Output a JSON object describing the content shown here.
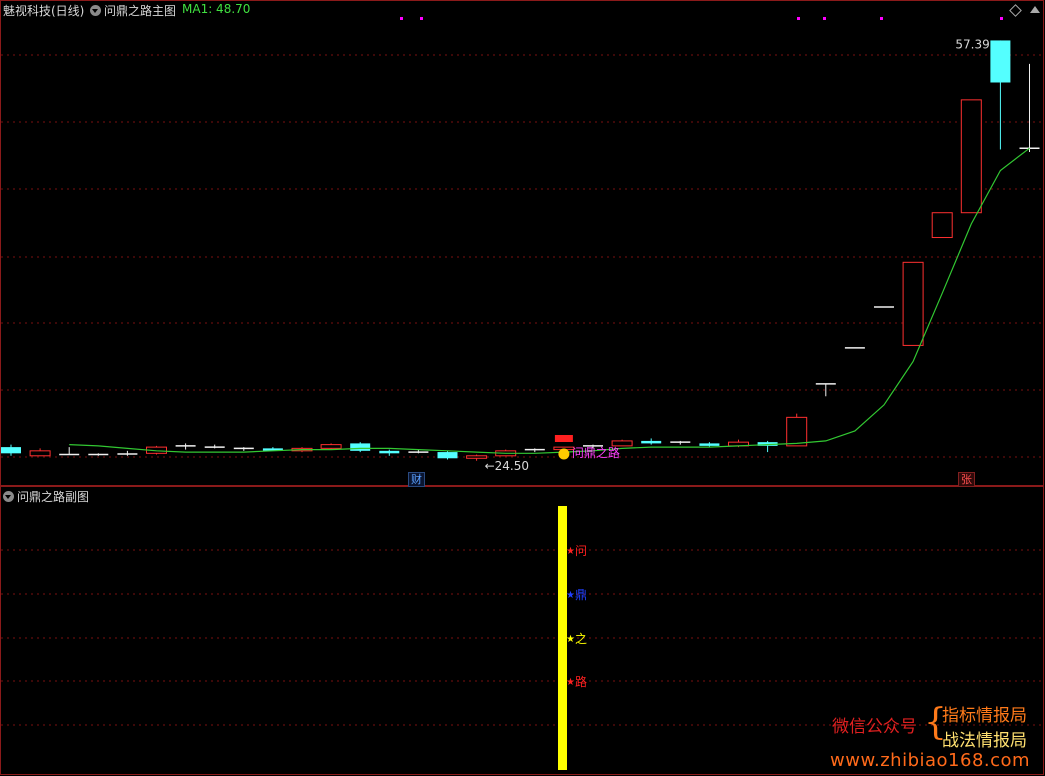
{
  "main_panel": {
    "title": "魅视科技(日线)",
    "indicator_name": "问鼎之路主图",
    "ma_label": "MA1: 48.70",
    "high_label": "57.39",
    "low_label": "←24.50",
    "signal_label": "问鼎之路",
    "marker_cai": "财",
    "marker_zhang": "张"
  },
  "sub_panel": {
    "title": "问鼎之路副图",
    "stars": [
      {
        "char": "问",
        "color": "#ff2020"
      },
      {
        "char": "鼎",
        "color": "#2040ff"
      },
      {
        "char": "之",
        "color": "#ffff00"
      },
      {
        "char": "路",
        "color": "#ff2020"
      }
    ]
  },
  "watermark": {
    "left": "微信公众号",
    "brace": "{",
    "line1": "指标情报局",
    "line2": "战法情报局",
    "site": "www.zhibiao168.com"
  },
  "colors": {
    "up": "#ff3030",
    "down": "#54ffff",
    "ma": "#32c832",
    "grid": "#7a1010",
    "signal_bar": "#ffff00"
  },
  "chart_data": {
    "type": "candlestick",
    "ylim": [
      23.4,
      59.2
    ],
    "series": [
      {
        "name": "MA1",
        "values": [
          24.8,
          24.7,
          24.5,
          24.3,
          24.2,
          24.2,
          24.2,
          24.3,
          24.4,
          24.4,
          24.5,
          24.5,
          24.4,
          24.3,
          24.2,
          24.1,
          24.1,
          24.2,
          24.3,
          24.5,
          24.6,
          24.6,
          24.6,
          24.7,
          24.8,
          24.9,
          25.1,
          25.9,
          28.0,
          31.5,
          37.0,
          42.6,
          46.9,
          48.7
        ]
      }
    ],
    "candles": [
      {
        "o": 24.6,
        "h": 24.8,
        "l": 23.9,
        "c": 24.1
      },
      {
        "o": 23.9,
        "h": 24.5,
        "l": 23.9,
        "c": 24.3
      },
      {
        "o": 24.1,
        "h": 24.6,
        "l": 24.0,
        "c": 24.0
      },
      {
        "o": 23.9,
        "h": 24.1,
        "l": 23.9,
        "c": 24.0
      },
      {
        "o": 23.95,
        "h": 24.3,
        "l": 23.9,
        "c": 24.05
      },
      {
        "o": 24.1,
        "h": 24.7,
        "l": 24.0,
        "c": 24.6
      },
      {
        "o": 24.6,
        "h": 24.9,
        "l": 24.4,
        "c": 24.7
      },
      {
        "o": 24.7,
        "h": 24.8,
        "l": 24.5,
        "c": 24.6
      },
      {
        "o": 24.4,
        "h": 24.6,
        "l": 24.3,
        "c": 24.5
      },
      {
        "o": 24.5,
        "h": 24.6,
        "l": 24.3,
        "c": 24.3
      },
      {
        "o": 24.3,
        "h": 24.6,
        "l": 24.2,
        "c": 24.5
      },
      {
        "o": 24.5,
        "h": 24.9,
        "l": 24.4,
        "c": 24.8
      },
      {
        "o": 24.9,
        "h": 25.0,
        "l": 24.2,
        "c": 24.3
      },
      {
        "o": 24.3,
        "h": 24.4,
        "l": 23.9,
        "c": 24.1
      },
      {
        "o": 24.3,
        "h": 24.4,
        "l": 24.1,
        "c": 24.2
      },
      {
        "o": 24.2,
        "h": 24.3,
        "l": 23.6,
        "c": 23.7
      },
      {
        "o": 23.7,
        "h": 24.0,
        "l": 23.5,
        "c": 23.9
      },
      {
        "o": 23.9,
        "h": 24.4,
        "l": 23.9,
        "c": 24.3
      },
      {
        "o": 24.3,
        "h": 24.5,
        "l": 24.2,
        "c": 24.4
      },
      {
        "o": 24.4,
        "h": 24.6,
        "l": 24.4,
        "c": 24.6
      },
      {
        "o": 24.6,
        "h": 24.8,
        "l": 24.5,
        "c": 24.7
      },
      {
        "o": 24.7,
        "h": 25.2,
        "l": 24.7,
        "c": 25.1
      },
      {
        "o": 25.1,
        "h": 25.3,
        "l": 24.8,
        "c": 24.9
      },
      {
        "o": 24.9,
        "h": 25.1,
        "l": 24.8,
        "c": 25.0
      },
      {
        "o": 24.9,
        "h": 25.0,
        "l": 24.6,
        "c": 24.7
      },
      {
        "o": 24.7,
        "h": 25.2,
        "l": 24.6,
        "c": 25.0
      },
      {
        "o": 25.0,
        "h": 25.1,
        "l": 24.2,
        "c": 24.7
      },
      {
        "o": 24.7,
        "h": 27.3,
        "l": 24.7,
        "c": 27.0
      },
      {
        "o": 29.7,
        "h": 29.7,
        "l": 28.7,
        "c": 29.7
      },
      {
        "o": 32.6,
        "h": 32.6,
        "l": 32.6,
        "c": 32.6
      },
      {
        "o": 35.9,
        "h": 35.9,
        "l": 35.9,
        "c": 35.9
      },
      {
        "o": 32.8,
        "h": 39.5,
        "l": 32.8,
        "c": 39.5
      },
      {
        "o": 41.5,
        "h": 43.5,
        "l": 41.5,
        "c": 43.5
      },
      {
        "o": 43.5,
        "h": 52.6,
        "l": 43.5,
        "c": 52.6
      },
      {
        "o": 57.39,
        "h": 57.39,
        "l": 48.6,
        "c": 54.0
      },
      {
        "o": 48.6,
        "h": 55.5,
        "l": 48.4,
        "c": 48.7
      }
    ],
    "high_marker": 57.39,
    "low_marker": 24.5
  }
}
